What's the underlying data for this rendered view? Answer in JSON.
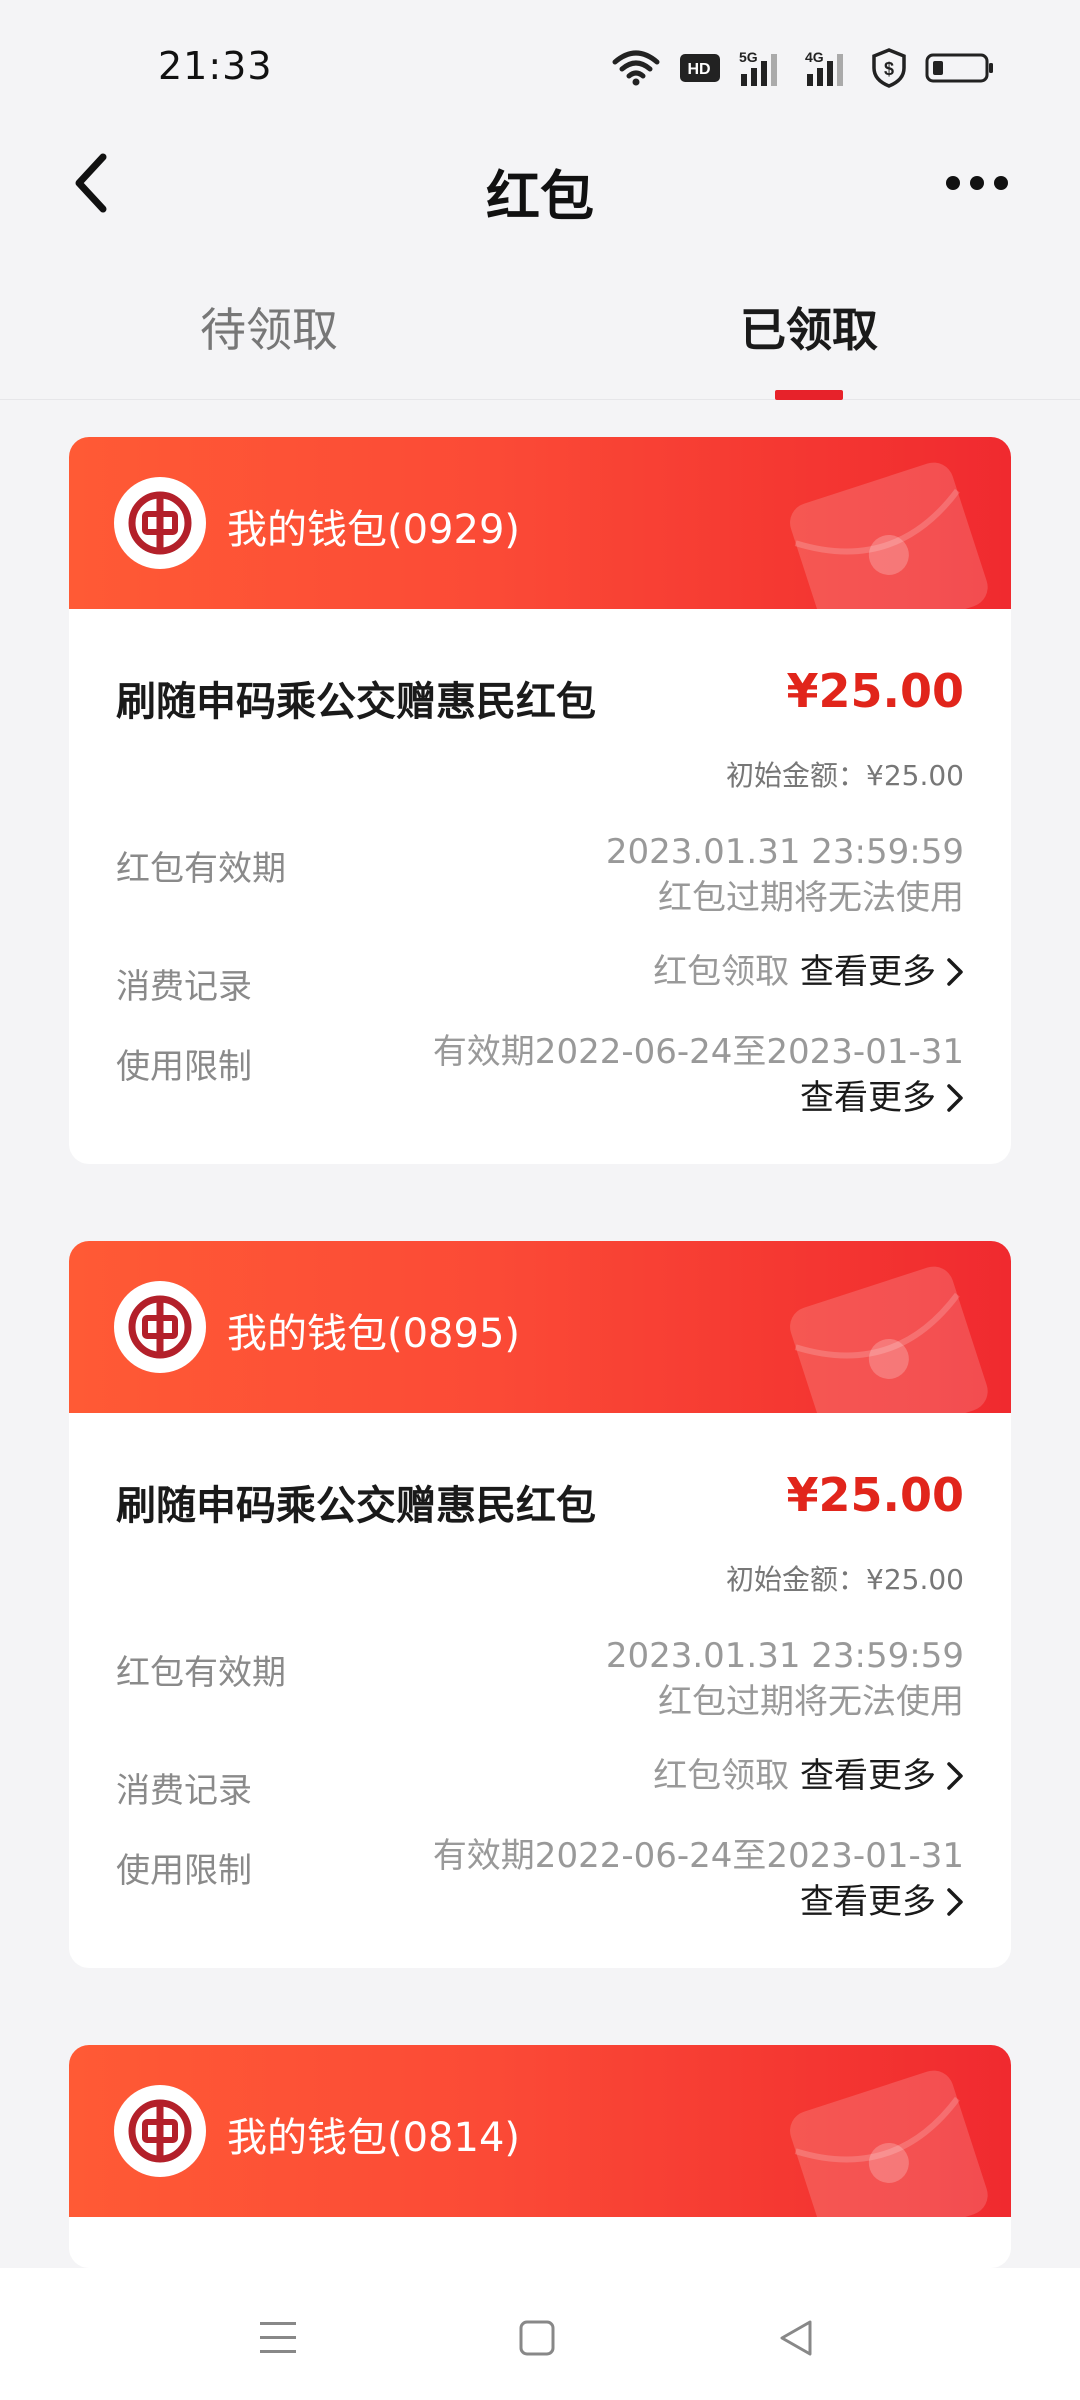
{
  "status_bar": {
    "time": "21:33",
    "icons": [
      "wifi-icon",
      "hd-icon",
      "signal-5g-icon",
      "signal-4g-icon",
      "security-icon",
      "battery-icon"
    ],
    "hd_label": "HD",
    "net1": "5G",
    "net2": "4G"
  },
  "header": {
    "title": "红包",
    "back_icon": "chevron-left-icon",
    "more_icon": "more-icon"
  },
  "tabs": [
    {
      "label": "待领取",
      "active": false
    },
    {
      "label": "已领取",
      "active": true
    }
  ],
  "colors": {
    "accent": "#e7222a",
    "amount": "#e1251b",
    "card_gradient_start": "#ff5a35",
    "card_gradient_end": "#f02a2f"
  },
  "cards": [
    {
      "wallet": "我的钱包(0929)",
      "title": "刷随申码乘公交赠惠民红包",
      "amount": "¥25.00",
      "initial_amount": "初始金额：¥25.00",
      "validity_label": "红包有效期",
      "validity_date": "2023.01.31 23:59:59",
      "validity_note": "红包过期将无法使用",
      "record_label": "消费记录",
      "record_value": "红包领取",
      "record_more": "查看更多",
      "limit_label": "使用限制",
      "limit_value": "有效期2022-06-24至2023-01-31",
      "limit_more": "查看更多"
    },
    {
      "wallet": "我的钱包(0895)",
      "title": "刷随申码乘公交赠惠民红包",
      "amount": "¥25.00",
      "initial_amount": "初始金额：¥25.00",
      "validity_label": "红包有效期",
      "validity_date": "2023.01.31 23:59:59",
      "validity_note": "红包过期将无法使用",
      "record_label": "消费记录",
      "record_value": "红包领取",
      "record_more": "查看更多",
      "limit_label": "使用限制",
      "limit_value": "有效期2022-06-24至2023-01-31",
      "limit_more": "查看更多"
    },
    {
      "wallet": "我的钱包(0814)"
    }
  ],
  "nav_bar": {
    "icons": [
      "menu-icon",
      "home-square-icon",
      "back-triangle-icon"
    ]
  }
}
